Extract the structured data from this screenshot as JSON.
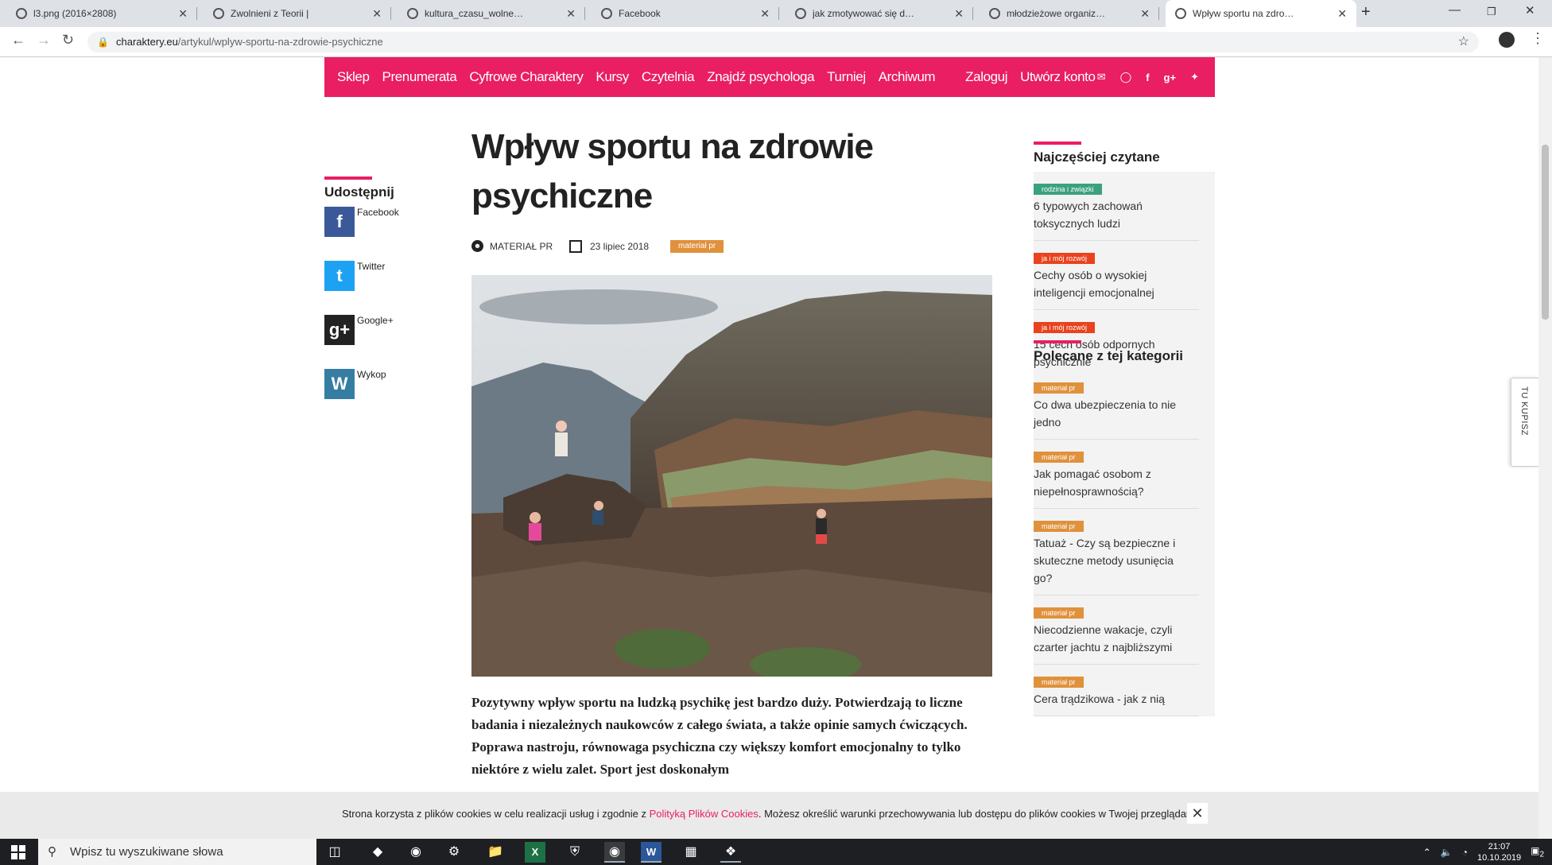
{
  "browser": {
    "tabs": [
      {
        "title": "l3.png (2016×2808)",
        "active": false
      },
      {
        "title": "Zwolnieni z Teorii |",
        "active": false
      },
      {
        "title": "kultura_czasu_wolnego_we_wspo",
        "active": false
      },
      {
        "title": "Facebook",
        "active": false
      },
      {
        "title": "jak zmotywować się do sportu - S",
        "active": false
      },
      {
        "title": "młodzieżowe organizacje sporto",
        "active": false
      },
      {
        "title": "Wpływ sportu na zdrowie psychi",
        "active": true
      }
    ],
    "url_domain": "charaktery.eu",
    "url_path": "/artykul/wplyw-sportu-na-zdrowie-psychiczne"
  },
  "site": {
    "nav": [
      "Sklep",
      "Prenumerata",
      "Cyfrowe Charaktery",
      "Kursy",
      "Czytelnia",
      "Znajdź psychologa",
      "Turniej",
      "Archiwum"
    ],
    "login": "Zaloguj",
    "register": "Utwórz konto",
    "nav_icons": [
      "mail-icon",
      "rss-icon",
      "facebook-icon",
      "google-plus-icon",
      "twitter-icon"
    ]
  },
  "article": {
    "title": "Wpływ sportu na zdrowie psychiczne",
    "author": "MATERIAŁ PR",
    "date": "23 lipiec 2018",
    "tag": "materiał pr",
    "lead": "Pozytywny wpływ sportu na ludzką psychikę jest bardzo duży. Potwierdzają to liczne badania i niezależnych naukowców z całego świata, a także opinie samych ćwiczących. Poprawa nastroju, równowaga psychiczna czy większy komfort emocjonalny to tylko niektóre z wielu zalet. Sport jest doskonałym"
  },
  "share": {
    "heading": "Udostępnij",
    "items": [
      {
        "label": "Facebook",
        "color": "#3b5998",
        "glyph": "f"
      },
      {
        "label": "Twitter",
        "color": "#1da1f2",
        "glyph": "t"
      },
      {
        "label": "Google+",
        "color": "#222222",
        "glyph": "g+"
      },
      {
        "label": "Wykop",
        "color": "#367da3",
        "glyph": "W"
      }
    ]
  },
  "sidebar": {
    "most_read_heading": "Najczęściej czytane",
    "most_read": [
      {
        "cat": "rodzina i związki",
        "cat_color": "#3aa17e",
        "title": "6 typowych zachowań toksycznych ludzi"
      },
      {
        "cat": "ja i mój rozwój",
        "cat_color": "#e8431e",
        "title": "Cechy osób o wysokiej inteligencji emocjonalnej"
      },
      {
        "cat": "ja i mój rozwój",
        "cat_color": "#e8431e",
        "title": "15 cech osób odpornych psychicznie"
      }
    ],
    "recommended_heading": "Polecane z tej kategorii",
    "recommended": [
      {
        "cat": "materiał pr",
        "cat_color": "#e0913c",
        "title": "Co dwa ubezpieczenia to nie jedno"
      },
      {
        "cat": "materiał pr",
        "cat_color": "#e0913c",
        "title": "Jak pomagać osobom z niepełnosprawnością?"
      },
      {
        "cat": "materiał pr",
        "cat_color": "#e0913c",
        "title": "Tatuaż - Czy są bezpieczne i skuteczne metody usunięcia go?"
      },
      {
        "cat": "materiał pr",
        "cat_color": "#e0913c",
        "title": "Niecodzienne wakacje, czyli czarter jachtu z najbliższymi"
      },
      {
        "cat": "materiał pr",
        "cat_color": "#e0913c",
        "title": "Cera trądzikowa - jak z nią"
      }
    ]
  },
  "tukupisz": "TU KUPISZ",
  "cookie": {
    "text_before": "Strona korzysta z plików cookies w celu realizacji usług i zgodnie z ",
    "link": "Polityką Plików Cookies",
    "text_after": ". Możesz określić warunki przechowywania lub dostępu do plików cookies w Twojej przeglądarce."
  },
  "taskbar": {
    "search_placeholder": "Wpisz tu wyszukiwane słowa",
    "time": "21:07",
    "date": "10.10.2019",
    "notifications": "2"
  },
  "colors": {
    "brand": "#e91e63",
    "pr_tag": "#e0913c"
  }
}
